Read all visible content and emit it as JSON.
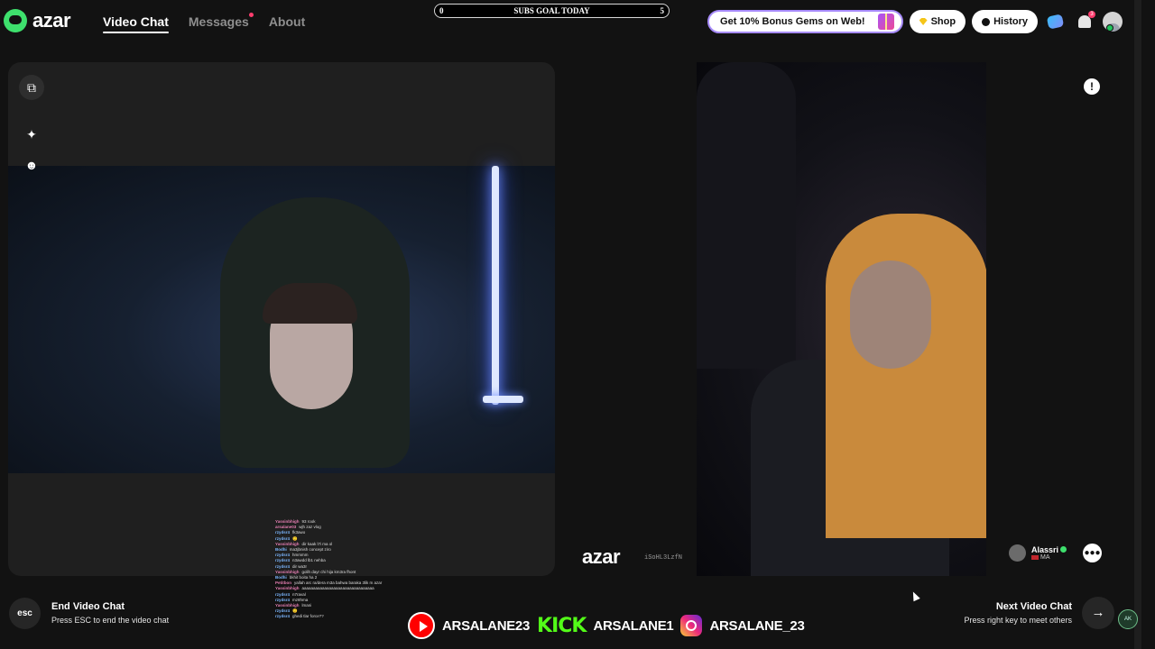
{
  "header": {
    "logo_text": "azar",
    "nav": [
      {
        "label": "Video Chat",
        "active": true
      },
      {
        "label": "Messages",
        "active": false,
        "has_notification_dot": true
      },
      {
        "label": "About",
        "active": false
      }
    ],
    "subs_goal": {
      "label": "SUBS GOAL TODAY",
      "current": "0",
      "target": "5"
    },
    "gems_promo": "Get 10% Bonus Gems on Web!",
    "shop_label": "Shop",
    "history_label": "History",
    "notification_count": "3"
  },
  "local_panel": {
    "side_icons": [
      "external-window-icon",
      "magic-wand-icon",
      "sticker-icon"
    ]
  },
  "remote_panel": {
    "watermark_logo": "azar",
    "watermark_id": "iSoHL3LzfN",
    "peer_name": "Alassri",
    "peer_country": "MA"
  },
  "stream_chat": [
    {
      "user": "Yassinbhigh",
      "text": "93 rook"
    },
    {
      "user": "arsalane03",
      "text": "wjh zaz vlog"
    },
    {
      "user": "rzydsr4",
      "text": "fk3awo"
    },
    {
      "user": "rzydsr4",
      "text": "🙂"
    },
    {
      "user": "Yassinbhigh",
      "text": "dir kaak l7i ma ol"
    },
    {
      "user": "Bodhi",
      "text": "ma3jbnish concept ziro"
    },
    {
      "user": "rzydsr4",
      "text": "hmmmm"
    },
    {
      "user": "rzydsr4",
      "text": "n3awdd lb1 nehba"
    },
    {
      "user": "rzydsr4",
      "text": "dir wa3r"
    },
    {
      "user": "Yassinbhigh",
      "text": "golih dayr chi hija km3ra fhont"
    },
    {
      "user": "Bodhi",
      "text": "bkhit boita ha 2"
    },
    {
      "user": "Petitbon",
      "text": "yallah arc ra/dera m3a bahwa baraka 3lik m azar"
    },
    {
      "user": "Yassinbhigh",
      "text": "aaaaaaaaaaaaaaaaaaaaaaaaaaaaaaaa"
    },
    {
      "user": "rzydsr4",
      "text": "n7raval"
    },
    {
      "user": "rzydsr4",
      "text": "mz8hma"
    },
    {
      "user": "Yassinbhigh",
      "text": "lmani"
    },
    {
      "user": "rzydsr4",
      "text": "🙂"
    },
    {
      "user": "rzydsr4",
      "text": "ghedi tlar force??"
    }
  ],
  "footer": {
    "esc_label": "esc",
    "end_title": "End Video Chat",
    "end_sub": "Press ESC to end the video chat",
    "next_title": "Next Video Chat",
    "next_sub": "Press right key to meet others",
    "next_icon": "arrow-right-icon",
    "corner_badge": "AK"
  },
  "socials": {
    "youtube_handle": "ARSALANE23",
    "kick_logo": "KICK",
    "kick_handle": "ARSALANE1",
    "instagram_handle": "ARSALANE_23"
  },
  "colors": {
    "background": "#121212",
    "brand_green": "#3ee06d",
    "kick_green": "#53fc18",
    "notification": "#ff3d6e"
  }
}
